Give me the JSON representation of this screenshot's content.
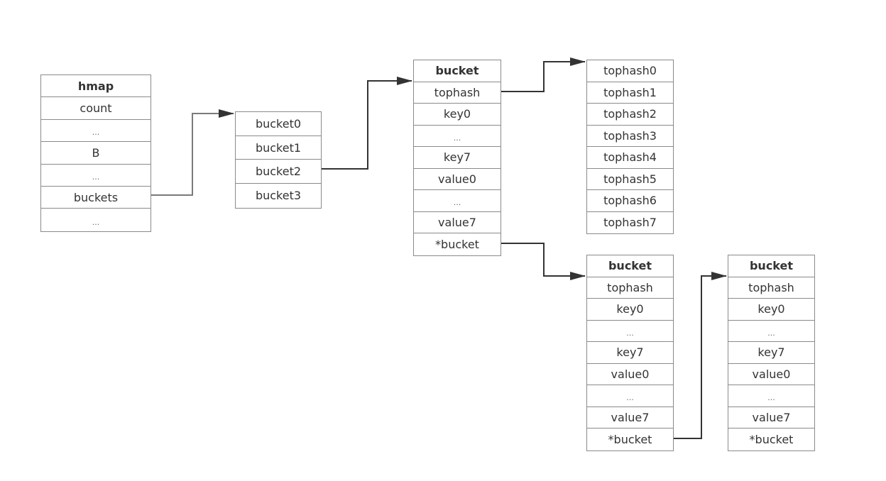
{
  "hmap": {
    "title": "hmap",
    "fields": [
      "count",
      "...",
      "B",
      "...",
      "buckets",
      "..."
    ]
  },
  "buckets_array": {
    "items": [
      "bucket0",
      "bucket1",
      "bucket2",
      "bucket3"
    ]
  },
  "bucket_struct": {
    "title": "bucket",
    "fields": [
      "tophash",
      "key0",
      "...",
      "key7",
      "value0",
      "...",
      "value7",
      "*bucket"
    ]
  },
  "tophash_array": {
    "items": [
      "tophash0",
      "tophash1",
      "tophash2",
      "tophash3",
      "tophash4",
      "tophash5",
      "tophash6",
      "tophash7"
    ]
  },
  "overflow_bucket_1": {
    "title": "bucket",
    "fields": [
      "tophash",
      "key0",
      "...",
      "key7",
      "value0",
      "...",
      "value7",
      "*bucket"
    ]
  },
  "overflow_bucket_2": {
    "title": "bucket",
    "fields": [
      "tophash",
      "key0",
      "...",
      "key7",
      "value0",
      "...",
      "value7",
      "*bucket"
    ]
  },
  "colors": {
    "border": "#8a8a8a",
    "arrow_light": "#7a7a7a",
    "arrow_dark": "#333333"
  }
}
